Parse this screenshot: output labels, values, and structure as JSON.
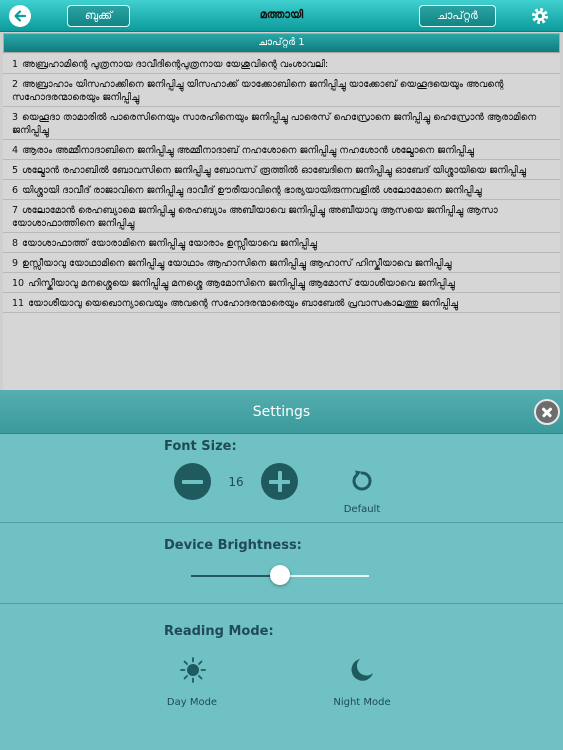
{
  "topbar": {
    "back_icon": "arrow-left-icon",
    "book_label": "ബുക്ക്",
    "title": "മത്തായി",
    "chapter_label": "ചാപ്റ്റർ",
    "settings_icon": "gear-icon"
  },
  "chapter_bar": {
    "label": "ചാപ്റ്റർ 1"
  },
  "verses": [
    {
      "num": "1",
      "text": "അബ്രഹാമിന്റെ പുത്രനായ ദാവീദിന്റെപുത്രനായ യേശുവിന്റെ വംശാവലി:"
    },
    {
      "num": "2",
      "text": "അബ്രാഹാം യിസഹാക്കിനെ ജനിപ്പിച്ചു യിസഹാക്ക് യാക്കോബിനെ ജനിപ്പിച്ചു യാക്കോബ് യെഹൂദയെയും അവന്റെ സഹോദരന്മാരെയും ജനിപ്പിച്ചു"
    },
    {
      "num": "3",
      "text": "യെഹൂദാ താമാരിൽ പാരെസിനെയും സാരഹിനെയും ജനിപ്പിച്ചു പാരെസ് ഹെസ്രോനെ ജനിപ്പിച്ചു ഹെസ്രോൻ ആരാമിനെ ജനിപ്പിച്ചു"
    },
    {
      "num": "4",
      "text": "ആരാം അമ്മീനാദാബിനെ ജനിപ്പിച്ചു അമ്മീനാദാബ് നഹശോനെ ജനിപ്പിച്ചു നഹശോൻ ശല്മോനെ ജനിപ്പിച്ചു"
    },
    {
      "num": "5",
      "text": "ശല്മോൻ രഹാബിൽ ബോവസിനെ ജനിപ്പിച്ചു ബോവസ് രൂത്തിൽ ഓബേദിനെ ജനിപ്പിച്ചു ഓബേദ് യിശ്ശായിയെ ജനിപ്പിച്ചു"
    },
    {
      "num": "6",
      "text": "യിശ്ശായി ദാവീദ് രാജാവിനെ ജനിപ്പിച്ചു ദാവീദ് ഊരീയാവിന്റെ ഭാര്യയായിരുന്നവളിൽ ശലോമോനെ ജനിപ്പിച്ചു"
    },
    {
      "num": "7",
      "text": "ശലോമോൻ രെഹബ്യാമെ ജനിപ്പിച്ചു രെഹബ്യാം അബീയാവെ ജനിപ്പിച്ചു അബീയാവു ആസയെ ജനിപ്പിച്ചു ആസാ യോശാഫാത്തിനെ ജനിപ്പിച്ചു"
    },
    {
      "num": "8",
      "text": "യോശാഫാത്ത് യോരാമിനെ ജനിപ്പിച്ചു യോരാം ഉസ്സീയാവെ ജനിപ്പിച്ചു"
    },
    {
      "num": "9",
      "text": "ഉസ്സീയാവു യോഥാമിനെ ജനിപ്പിച്ചു യോഥാം ആഹാസിനെ ജനിപ്പിച്ചു ആഹാസ് ഹിസ്കീയാവെ ജനിപ്പിച്ചു"
    },
    {
      "num": "10",
      "text": "ഹിസ്കീയാവു മനശ്ശെയെ ജനിപ്പിച്ചു മനശ്ശെ ആമോസിനെ ജനിപ്പിച്ചു ആമോസ് യോശീയാവെ ജനിപ്പിച്ചു"
    },
    {
      "num": "11",
      "text": "യോശീയാവു യെഖൊന്യാവെയും അവന്റെ സഹോദരന്മാരെയും ബാബേൽ പ്രവാസകാലത്തു ജനിപ്പിച്ചു"
    }
  ],
  "settings": {
    "title": "Settings",
    "close_icon": "close-icon",
    "font_size": {
      "label": "Font Size:",
      "value": "16",
      "decrease_icon": "minus-icon",
      "increase_icon": "plus-icon",
      "reset_icon": "reset-icon",
      "reset_label": "Default"
    },
    "brightness": {
      "label": "Device Brightness:",
      "level": 0.5
    },
    "reading_mode": {
      "label": "Reading Mode:",
      "day_label": "Day Mode",
      "day_icon": "sun-icon",
      "night_label": "Night Mode",
      "night_icon": "moon-icon"
    }
  },
  "colors": {
    "accent": "#0d9b9c",
    "panel": "#6fc1c3",
    "dark": "#1f5a5f",
    "text_dark": "#1f4a56"
  }
}
